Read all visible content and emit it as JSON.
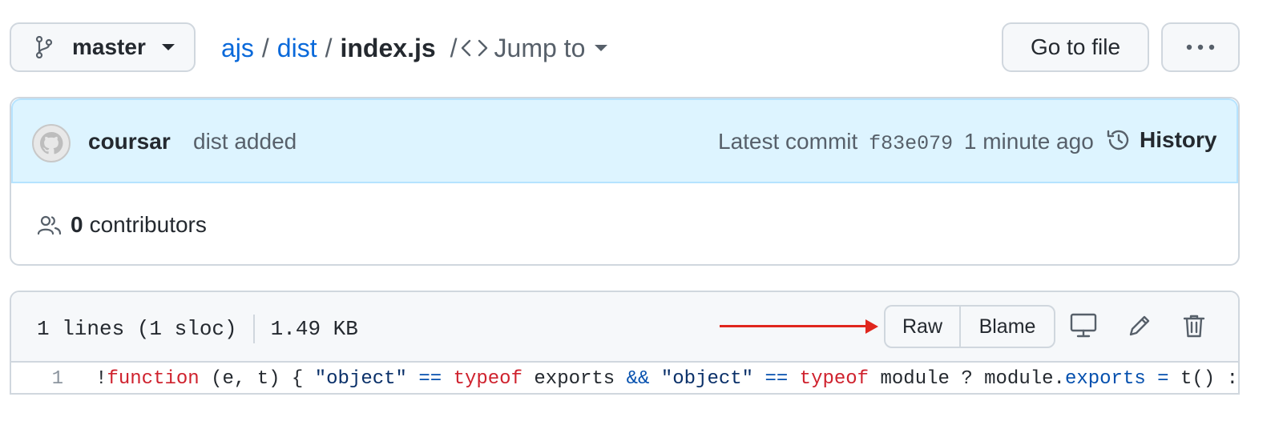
{
  "branch": {
    "name": "master"
  },
  "breadcrumb": {
    "repo": "ajs",
    "folder": "dist",
    "file": "index.js",
    "separator": "/",
    "jump_label": "Jump to"
  },
  "toolbar": {
    "go_to_file_label": "Go to file",
    "more_label": "···"
  },
  "commit": {
    "author": "coursar",
    "message": "dist added",
    "latest_label": "Latest commit",
    "sha": "f83e079",
    "time": "1 minute ago",
    "history_label": "History"
  },
  "contributors": {
    "count": "0",
    "label": "contributors"
  },
  "file": {
    "lines_info": "1 lines (1 sloc)",
    "size": "1.49 KB",
    "raw_label": "Raw",
    "blame_label": "Blame"
  },
  "code": {
    "line_number": "1",
    "tokens": [
      {
        "t": "!",
        "c": ""
      },
      {
        "t": "function",
        "c": "kw"
      },
      {
        "t": " (e, t) { ",
        "c": ""
      },
      {
        "t": "\"object\"",
        "c": "str"
      },
      {
        "t": " ",
        "c": ""
      },
      {
        "t": "==",
        "c": "op"
      },
      {
        "t": " ",
        "c": ""
      },
      {
        "t": "typeof",
        "c": "kw"
      },
      {
        "t": " exports ",
        "c": ""
      },
      {
        "t": "&&",
        "c": "op"
      },
      {
        "t": " ",
        "c": ""
      },
      {
        "t": "\"object\"",
        "c": "str"
      },
      {
        "t": " ",
        "c": ""
      },
      {
        "t": "==",
        "c": "op"
      },
      {
        "t": " ",
        "c": ""
      },
      {
        "t": "typeof",
        "c": "kw"
      },
      {
        "t": " module ? module.",
        "c": ""
      },
      {
        "t": "exports",
        "c": "op"
      },
      {
        "t": " ",
        "c": ""
      },
      {
        "t": "=",
        "c": "op"
      },
      {
        "t": " t() : ",
        "c": ""
      }
    ]
  },
  "colors": {
    "link": "#0969da",
    "annotation_arrow": "#e0261d",
    "commit_bar": "#ddf4ff"
  }
}
